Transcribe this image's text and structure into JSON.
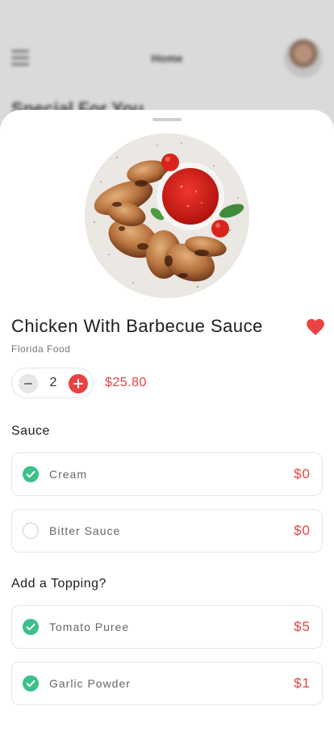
{
  "background": {
    "header_title": "Home",
    "heading": "Special For You"
  },
  "product": {
    "image_icon": "chicken-wings-with-bbq-dip",
    "title": "Chicken With Barbecue Sauce",
    "subtitle": "Florida Food",
    "favorited": true,
    "quantity": "2",
    "price": "$25.80"
  },
  "sections": [
    {
      "title": "Sauce",
      "options": [
        {
          "label": "Cream",
          "price": "$0",
          "checked": true
        },
        {
          "label": "Bitter Sauce",
          "price": "$0",
          "checked": false
        }
      ]
    },
    {
      "title": "Add a Topping?",
      "options": [
        {
          "label": "Tomato Puree",
          "price": "$5",
          "checked": true
        },
        {
          "label": "Garlic Powder",
          "price": "$1",
          "checked": true
        }
      ]
    }
  ],
  "colors": {
    "accent": "#e84342",
    "check": "#3cc08c"
  }
}
